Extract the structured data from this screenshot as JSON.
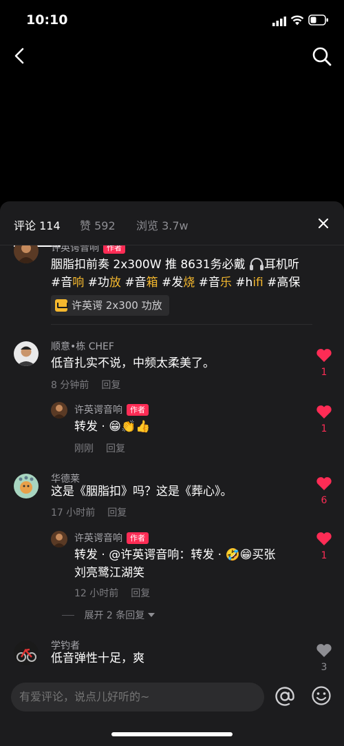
{
  "status_bar": {
    "time": "10:10"
  },
  "tabs": [
    {
      "label": "评论 114"
    },
    {
      "label": "赞 592"
    },
    {
      "label": "浏览 3.7w"
    }
  ],
  "author_badge": "作者",
  "post": {
    "user": "许英谔音响",
    "line1": "胭脂扣前奏 2x300W 推 8631务必戴",
    "line1_after_icon": "耳机听",
    "hashtags": [
      {
        "pre": "#音",
        "hl": "响"
      },
      {
        "pre": "#功",
        "hl": "放"
      },
      {
        "pre": "#音",
        "hl": "箱"
      },
      {
        "pre": "#发",
        "hl": "烧"
      },
      {
        "pre": "#音",
        "hl": "乐"
      },
      {
        "pre": "#h",
        "hl": "ifi"
      },
      {
        "pre": "#高保",
        "hl": ""
      }
    ],
    "product": "许英谔 2x300 功放"
  },
  "comments": [
    {
      "user": "顺意•栋 CHEF",
      "text": "低音扎实不说，中频太柔美了。",
      "time": "8 分钟前",
      "reply_label": "回复",
      "likes": "1",
      "reply": {
        "user": "许英谔音响",
        "text": "转发 ·",
        "time": "刚刚",
        "reply_label": "回复",
        "likes": "1"
      }
    },
    {
      "user": "华德莱",
      "text": "这是《胭脂扣》吗？这是《葬心》。",
      "time": "17 小时前",
      "reply_label": "回复",
      "likes": "6",
      "reply": {
        "user": "许英谔音响",
        "text_a": "转发 · @许英谔音响：转发 ·",
        "text_b": "买张",
        "text_line2": "刘亮鹭江湖笑",
        "time": "12 小时前",
        "reply_label": "回复",
        "likes": "1"
      },
      "expand": "展开 2 条回复"
    },
    {
      "user": "学钓者",
      "text": "低音弹性十足，爽",
      "likes": "3"
    }
  ],
  "input": {
    "placeholder": "有爱评论，说点儿好听的~"
  },
  "colors": {
    "accent": "#fe2c55",
    "highlight": "#f5b82e",
    "sheet": "#1c1c1e"
  }
}
